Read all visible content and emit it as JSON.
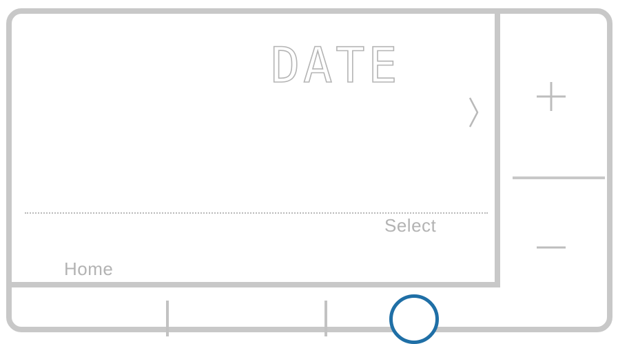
{
  "screen": {
    "title": "DATE",
    "select_label": "Select",
    "home_label": "Home"
  },
  "icons": {
    "next": "chevron-right-icon",
    "increase": "plus-icon",
    "decrease": "minus-icon",
    "center": "circle-button-icon"
  },
  "colors": {
    "frame": "#c8c8c8",
    "label_text": "#b3b3b3",
    "circle_accent": "#1f6fa6"
  }
}
